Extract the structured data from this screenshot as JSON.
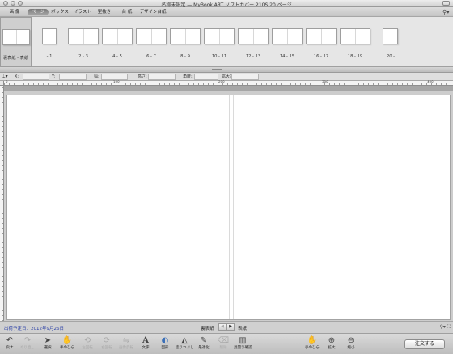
{
  "window": {
    "title": "名称未設定 — MyBook ART ソフトカバー 210S 20 ページ"
  },
  "tabs": [
    {
      "label": "画 像",
      "active": false
    },
    {
      "label": "ページ",
      "active": true
    },
    {
      "label": "ボックス",
      "active": false
    },
    {
      "label": "イラスト",
      "active": false
    },
    {
      "label": "型抜き",
      "active": false
    },
    {
      "label": "台 紙",
      "active": false
    },
    {
      "label": "デザイン台紙",
      "active": false
    }
  ],
  "pages": [
    {
      "label": "裏表紙 - 表紙",
      "selected": true
    },
    {
      "label": "- 1",
      "selected": false
    },
    {
      "label": "2 - 3",
      "selected": false
    },
    {
      "label": "4 - 5",
      "selected": false
    },
    {
      "label": "6 - 7",
      "selected": false
    },
    {
      "label": "8 - 9",
      "selected": false
    },
    {
      "label": "10 - 11",
      "selected": false
    },
    {
      "label": "12 - 13",
      "selected": false
    },
    {
      "label": "14 - 15",
      "selected": false
    },
    {
      "label": "16 - 17",
      "selected": false
    },
    {
      "label": "18 - 19",
      "selected": false
    },
    {
      "label": "20 -",
      "selected": false
    }
  ],
  "properties": {
    "x_label": "X:",
    "y_label": "Y:",
    "width_label": "幅:",
    "height_label": "高さ:",
    "angle_label": "角度:",
    "zoom_label": "拡大率:",
    "x_value": "",
    "y_value": "",
    "width_value": "",
    "height_value": "",
    "angle_value": "",
    "zoom_value": ""
  },
  "ruler": {
    "ticks": [
      "0",
      "100",
      "200",
      "300",
      "400"
    ]
  },
  "status": {
    "deadline": "出荷予定日：2012年9月26日",
    "nav_left": "裏表紙",
    "nav_right": "表紙",
    "prev_arrow": "◀",
    "next_arrow": "▶"
  },
  "toolbar": {
    "tools": [
      {
        "label": "戻す",
        "icon": "undo-icon",
        "glyph": "↶",
        "disabled": false
      },
      {
        "label": "やり直し",
        "icon": "redo-icon",
        "glyph": "↷",
        "disabled": true
      },
      {
        "label": "選択",
        "icon": "select-arrow-icon",
        "glyph": "➤",
        "disabled": false
      },
      {
        "label": "手のひら",
        "icon": "hand-icon",
        "glyph": "✋",
        "disabled": false
      },
      {
        "label": "左回転",
        "icon": "rotate-left-icon",
        "glyph": "⟲",
        "disabled": true
      },
      {
        "label": "右回転",
        "icon": "rotate-right-icon",
        "glyph": "⟳",
        "disabled": true
      },
      {
        "label": "画像反転",
        "icon": "flip-icon",
        "glyph": "⇋",
        "disabled": true
      },
      {
        "label": "文字",
        "icon": "text-icon",
        "glyph": "A",
        "disabled": false
      },
      {
        "label": "図形",
        "icon": "shape-icon",
        "glyph": "◐",
        "disabled": false
      },
      {
        "label": "塗りつぶし",
        "icon": "fill-icon",
        "glyph": "◭",
        "disabled": false
      },
      {
        "label": "最適化",
        "icon": "optimize-icon",
        "glyph": "✎",
        "disabled": false
      },
      {
        "label": "削除",
        "icon": "delete-icon",
        "glyph": "⌫",
        "disabled": true
      },
      {
        "label": "見開き確認",
        "icon": "spread-preview-icon",
        "glyph": "▥",
        "disabled": false
      },
      {
        "label": "手のひら",
        "icon": "hand-icon",
        "glyph": "✋",
        "disabled": false
      },
      {
        "label": "拡大",
        "icon": "zoom-in-icon",
        "glyph": "⊕",
        "disabled": false
      },
      {
        "label": "縮小",
        "icon": "zoom-out-icon",
        "glyph": "⊖",
        "disabled": false
      }
    ],
    "order_button": "注文する"
  }
}
